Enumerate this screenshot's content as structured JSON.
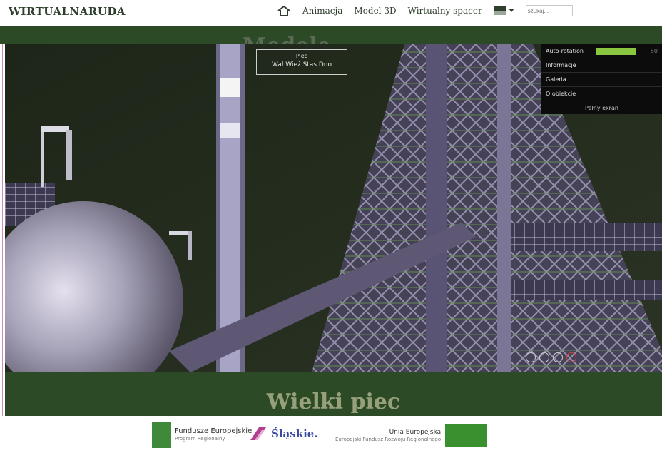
{
  "header": {
    "logo": "WIRTUALNARUDA",
    "nav": [
      "Animacja",
      "Model 3D",
      "Wirtualny spacer"
    ],
    "search_placeholder": "szukaj..."
  },
  "band_title": "Modele",
  "viewer": {
    "hotspot": {
      "label": "Piec",
      "options": "Wał  Wież  Stas  Dno"
    },
    "panel": {
      "auto_rotation_label": "Auto-rotation",
      "auto_rotation_value": "80",
      "items": [
        "Informacje",
        "Galeria",
        "O obiekcie"
      ],
      "fullscreen": "Pełny ekran"
    }
  },
  "section_title": "Wielki piec",
  "footer": {
    "fe_title": "Fundusze Europejskie",
    "fe_sub": "Program Regionalny",
    "slaskie": "Śląskie.",
    "ue_title": "Unia Europejska",
    "ue_sub": "Europejski Fundusz Rozwoju Regionalnego"
  },
  "colors": {
    "band": "#2d4a27",
    "accent": "#8ac640",
    "background": "#ffffff"
  }
}
